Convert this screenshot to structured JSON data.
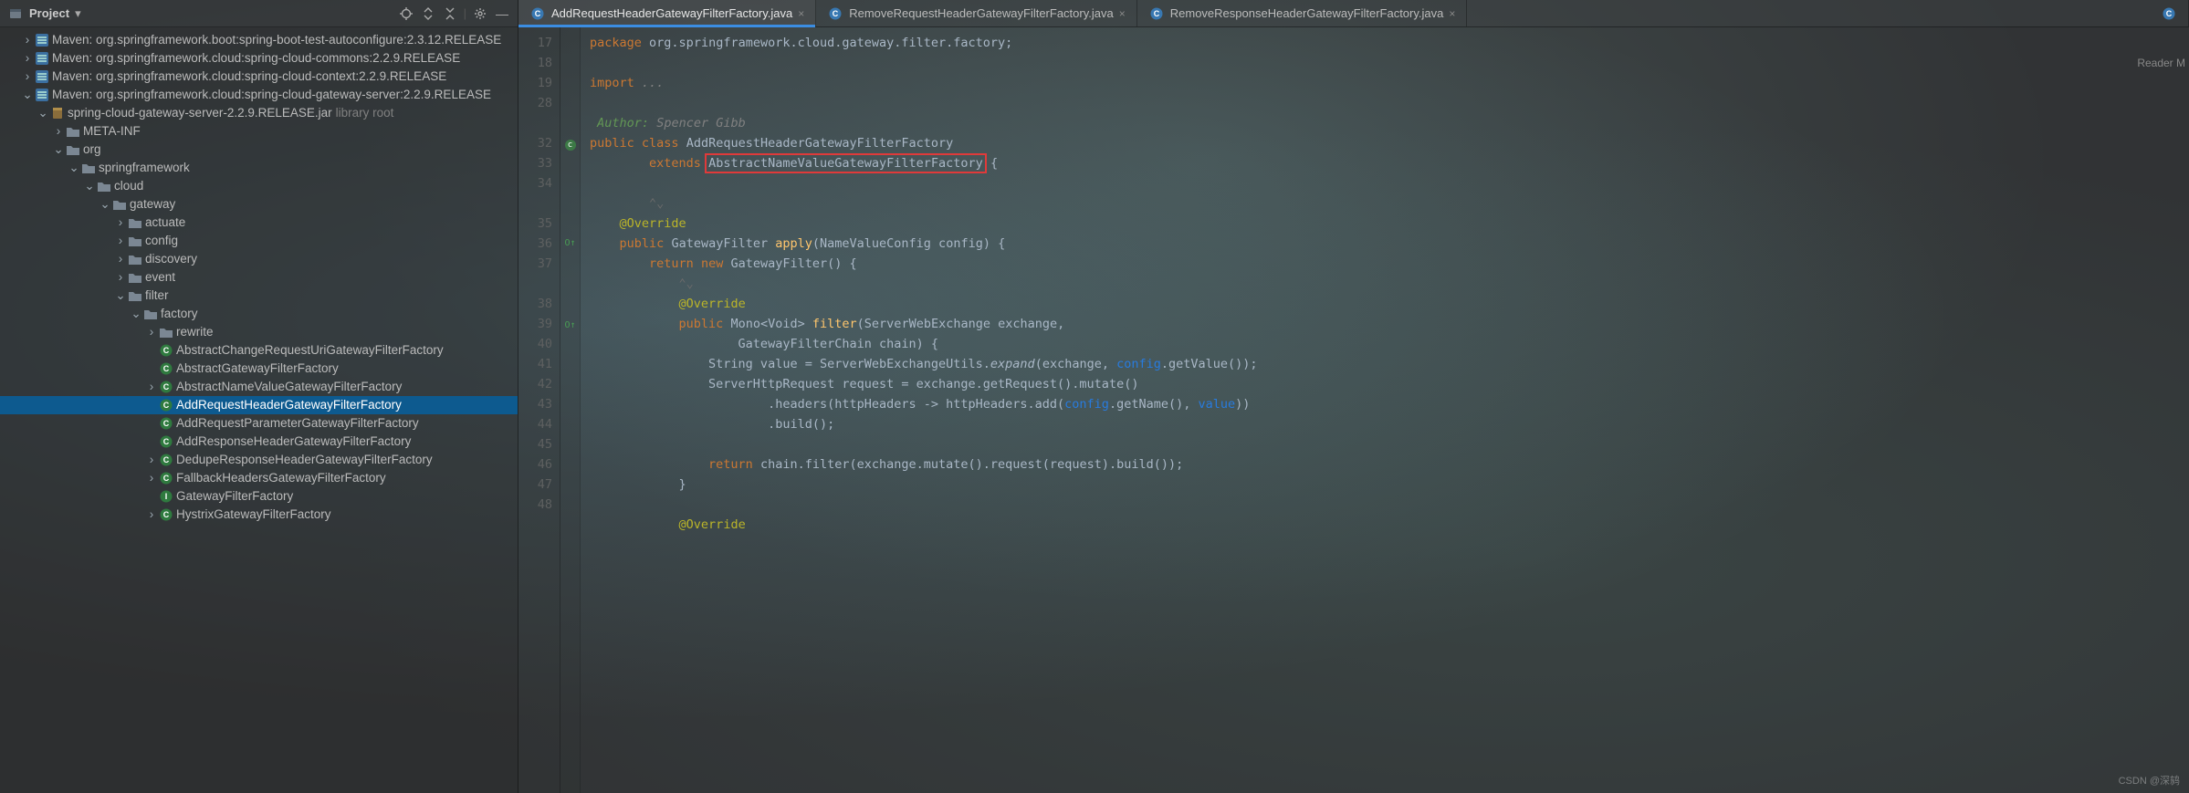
{
  "sidebar": {
    "title": "Project",
    "nodes": [
      {
        "indent": 1,
        "arrow": "›",
        "iconset": "mvn",
        "label": "Maven: org.springframework.boot:spring-boot-test-autoconfigure:2.3.12.RELEASE"
      },
      {
        "indent": 1,
        "arrow": "›",
        "iconset": "mvn",
        "label": "Maven: org.springframework.cloud:spring-cloud-commons:2.2.9.RELEASE"
      },
      {
        "indent": 1,
        "arrow": "›",
        "iconset": "mvn",
        "label": "Maven: org.springframework.cloud:spring-cloud-context:2.2.9.RELEASE"
      },
      {
        "indent": 1,
        "arrow": "⌄",
        "iconset": "mvn",
        "label": "Maven: org.springframework.cloud:spring-cloud-gateway-server:2.2.9.RELEASE"
      },
      {
        "indent": 2,
        "arrow": "⌄",
        "iconset": "jar",
        "label": "spring-cloud-gateway-server-2.2.9.RELEASE.jar",
        "suffix": "library root"
      },
      {
        "indent": 3,
        "arrow": "›",
        "iconset": "folder",
        "label": "META-INF"
      },
      {
        "indent": 3,
        "arrow": "⌄",
        "iconset": "folder",
        "label": "org"
      },
      {
        "indent": 4,
        "arrow": "⌄",
        "iconset": "folder",
        "label": "springframework"
      },
      {
        "indent": 5,
        "arrow": "⌄",
        "iconset": "folder",
        "label": "cloud"
      },
      {
        "indent": 6,
        "arrow": "⌄",
        "iconset": "folder",
        "label": "gateway"
      },
      {
        "indent": 7,
        "arrow": "›",
        "iconset": "folder",
        "label": "actuate"
      },
      {
        "indent": 7,
        "arrow": "›",
        "iconset": "folder",
        "label": "config"
      },
      {
        "indent": 7,
        "arrow": "›",
        "iconset": "folder",
        "label": "discovery"
      },
      {
        "indent": 7,
        "arrow": "›",
        "iconset": "folder",
        "label": "event"
      },
      {
        "indent": 7,
        "arrow": "⌄",
        "iconset": "folder",
        "label": "filter"
      },
      {
        "indent": 8,
        "arrow": "⌄",
        "iconset": "folder",
        "label": "factory"
      },
      {
        "indent": 9,
        "arrow": "›",
        "iconset": "folder",
        "label": "rewrite"
      },
      {
        "indent": 9,
        "arrow": "",
        "iconset": "class",
        "label": "AbstractChangeRequestUriGatewayFilterFactory"
      },
      {
        "indent": 9,
        "arrow": "",
        "iconset": "class",
        "label": "AbstractGatewayFilterFactory"
      },
      {
        "indent": 9,
        "arrow": "›",
        "iconset": "class",
        "label": "AbstractNameValueGatewayFilterFactory"
      },
      {
        "indent": 9,
        "arrow": "",
        "iconset": "class",
        "label": "AddRequestHeaderGatewayFilterFactory",
        "selected": true
      },
      {
        "indent": 9,
        "arrow": "",
        "iconset": "class",
        "label": "AddRequestParameterGatewayFilterFactory"
      },
      {
        "indent": 9,
        "arrow": "",
        "iconset": "class",
        "label": "AddResponseHeaderGatewayFilterFactory"
      },
      {
        "indent": 9,
        "arrow": "›",
        "iconset": "class",
        "label": "DedupeResponseHeaderGatewayFilterFactory"
      },
      {
        "indent": 9,
        "arrow": "›",
        "iconset": "class",
        "label": "FallbackHeadersGatewayFilterFactory"
      },
      {
        "indent": 9,
        "arrow": "",
        "iconset": "int",
        "label": "GatewayFilterFactory"
      },
      {
        "indent": 9,
        "arrow": "›",
        "iconset": "class",
        "label": "HystrixGatewayFilterFactory"
      }
    ]
  },
  "tabs": [
    {
      "label": "AddRequestHeaderGatewayFilterFactory.java",
      "active": true
    },
    {
      "label": "RemoveRequestHeaderGatewayFilterFactory.java",
      "active": false
    },
    {
      "label": "RemoveResponseHeaderGatewayFilterFactory.java",
      "active": false
    }
  ],
  "readerMode": "Reader M",
  "watermark": "CSDN @深鸫",
  "code": {
    "lineNumbers": [
      "17",
      "18",
      "19",
      "28",
      "",
      "32",
      "33",
      "34",
      "",
      "35",
      "36",
      "37",
      "",
      "38",
      "39",
      "40",
      "41",
      "42",
      "43",
      "44",
      "45",
      "46",
      "47",
      "48",
      ""
    ],
    "gutterMarks": [
      "",
      "",
      "",
      "",
      "",
      "C",
      "",
      "",
      "",
      "",
      "O↑",
      "",
      "",
      "",
      "O↑",
      "",
      "",
      "",
      "",
      "",
      "",
      "",
      "",
      "",
      ""
    ],
    "lines": [
      "<span class='kw'>package</span> <span class='pkgline'>org.springframework.cloud.gateway.filter.factory;</span>",
      "",
      "<span class='kw'>import</span> <span class='comment'>...</span>",
      "",
      " <span class='docTag'>Author:</span> <span class='comment'>Spencer Gibb</span>",
      "<span class='kw'>public</span> <span class='kw'>class</span> <span class='type'>AddRequestHeaderGatewayFilterFactory</span>",
      "        <span class='kw'>extends</span> <span id='hl-target'>AbstractNameValueGatewayFilterFactory</span> {",
      "",
      "        <span style='color:#6b6b6b'>⌃⌄</span>",
      "    <span class='annot'>@Override</span>",
      "    <span class='kw'>public</span> <span class='type'>GatewayFilter</span> <span class='fn'>apply</span>(NameValueConfig config) {",
      "        <span class='kw'>return</span> <span class='kw'>new</span> <span class='type'>GatewayFilter</span>() {",
      "            <span style='color:#6b6b6b'>⌃⌄</span>",
      "            <span class='annot'>@Override</span>",
      "            <span class='kw'>public</span> <span class='type'>Mono&lt;Void&gt;</span> <span class='fn'>filter</span>(ServerWebExchange exchange,",
      "                    GatewayFilterChain chain) {",
      "                String value = ServerWebExchangeUtils.<span style='font-style:italic'>expand</span>(exchange, <span class='link'>config</span>.getValue());",
      "                ServerHttpRequest request = exchange.getRequest().mutate()",
      "                        .headers(httpHeaders -> httpHeaders.add(<span class='link'>config</span>.getName(), <span class='link'>value</span>))",
      "                        .build();",
      "",
      "                <span class='kw'>return</span> chain.filter(exchange.mutate().request(request).build());",
      "            }",
      "",
      "            <span class='annot'>@Override</span>"
    ],
    "highlight": {
      "text": "AbstractNameValueGatewayFilterFactory"
    }
  }
}
